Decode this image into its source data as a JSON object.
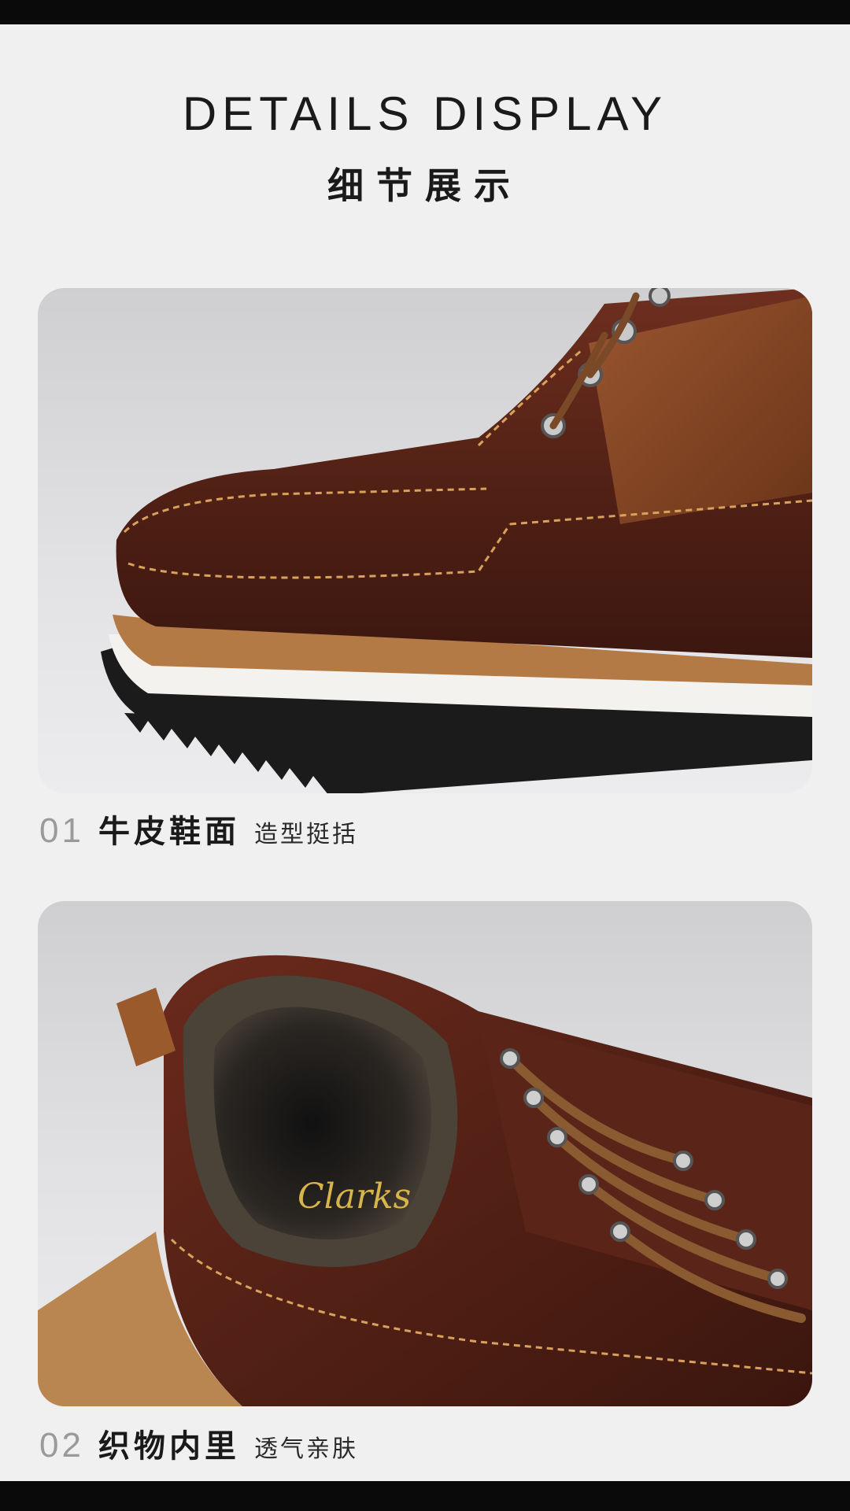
{
  "header": {
    "title_en": "DETAILS DISPLAY",
    "title_zh": "细节展示"
  },
  "details": [
    {
      "number": "01",
      "title": "牛皮鞋面",
      "subtitle": "造型挺括",
      "image_subject": "leather-toe-closeup"
    },
    {
      "number": "02",
      "title": "织物内里",
      "subtitle": "透气亲肤",
      "image_subject": "boot-collar-lining"
    }
  ],
  "brand_logo_text": "Clarks",
  "colors": {
    "top_bar": "#0a0a0a",
    "background": "#f0f0f0",
    "leather": "#5a2518",
    "suede": "#8a4a25",
    "stitching": "#d9a25c",
    "sole": "#1b1b1b",
    "number_gray": "#9a9a9a"
  }
}
